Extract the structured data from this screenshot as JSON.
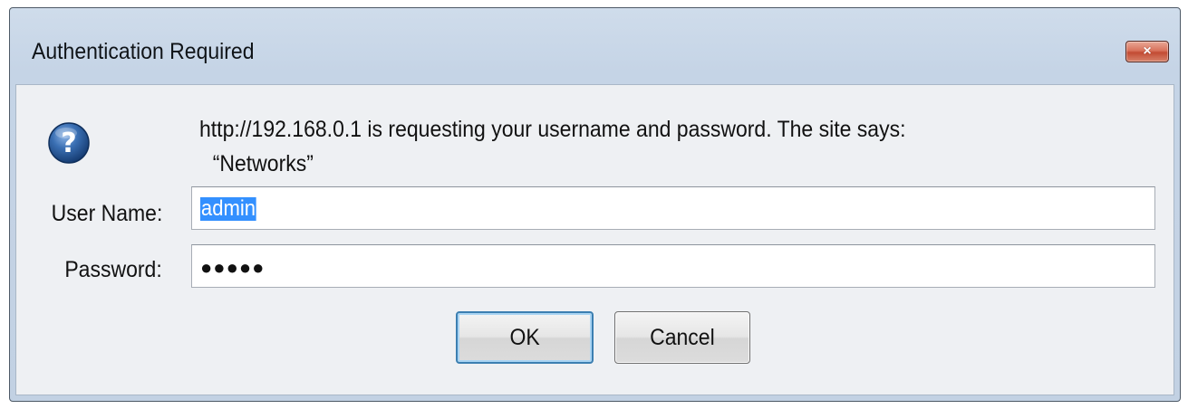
{
  "dialog": {
    "title": "Authentication Required",
    "close_label": "×",
    "message_line1": "http://192.168.0.1 is requesting your username and password. The site says:",
    "message_line2": "“Networks”",
    "icon": "question-icon"
  },
  "form": {
    "username_label": "User Name:",
    "username_value": "admin",
    "password_label": "Password:",
    "password_value": "●●●●●"
  },
  "buttons": {
    "ok_label": "OK",
    "cancel_label": "Cancel"
  },
  "colors": {
    "titlebar": "#c5d4e6",
    "selection": "#3390ff",
    "close_button": "#c24b33",
    "icon_blue": "#1f4f8c"
  }
}
